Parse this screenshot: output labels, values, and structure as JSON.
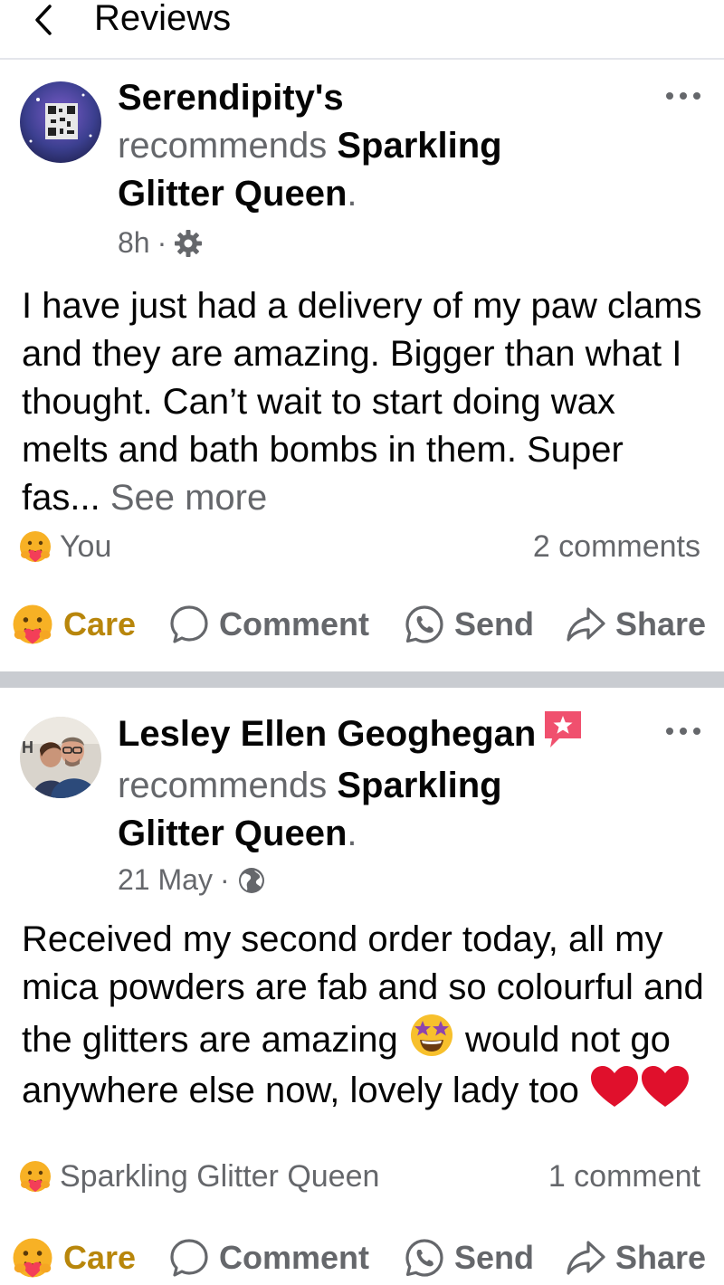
{
  "header": {
    "title": "Reviews"
  },
  "posts": [
    {
      "author": "Serendipity's",
      "verb": "recommends",
      "page": "Sparkling Glitter Queen",
      "period": ".",
      "time": "8h",
      "separator": "·",
      "privacy_icon": "gear-icon",
      "body": "I have just had a delivery of my paw clams and they are amazing. Bigger than what I thought. Can’t wait to start doing wax melts and bath bombs in them. Super fas...",
      "see_more": "See more",
      "reactors": "You",
      "comments": "2 comments",
      "actions": {
        "care": "Care",
        "comment": "Comment",
        "send": "Send",
        "share": "Share"
      }
    },
    {
      "author": "Lesley Ellen Geoghegan",
      "verb": "recommends",
      "page": "Sparkling Glitter Queen",
      "period": ".",
      "time": "21 May",
      "separator": "·",
      "privacy_icon": "globe-icon",
      "body_part1": "Received my second order today, all my mica powders are fab and so colourful and the glitters are amazing",
      "body_part2": "would not go anywhere else now, lovely lady too",
      "reactors": "Sparkling Glitter Queen",
      "comments": "1 comment",
      "actions": {
        "care": "Care",
        "comment": "Comment",
        "send": "Send",
        "share": "Share"
      }
    }
  ],
  "colors": {
    "text_primary": "#050505",
    "text_secondary": "#65676b",
    "care_label": "#b8860b",
    "divider": "#c9ccd1",
    "badge": "#f0506e"
  }
}
